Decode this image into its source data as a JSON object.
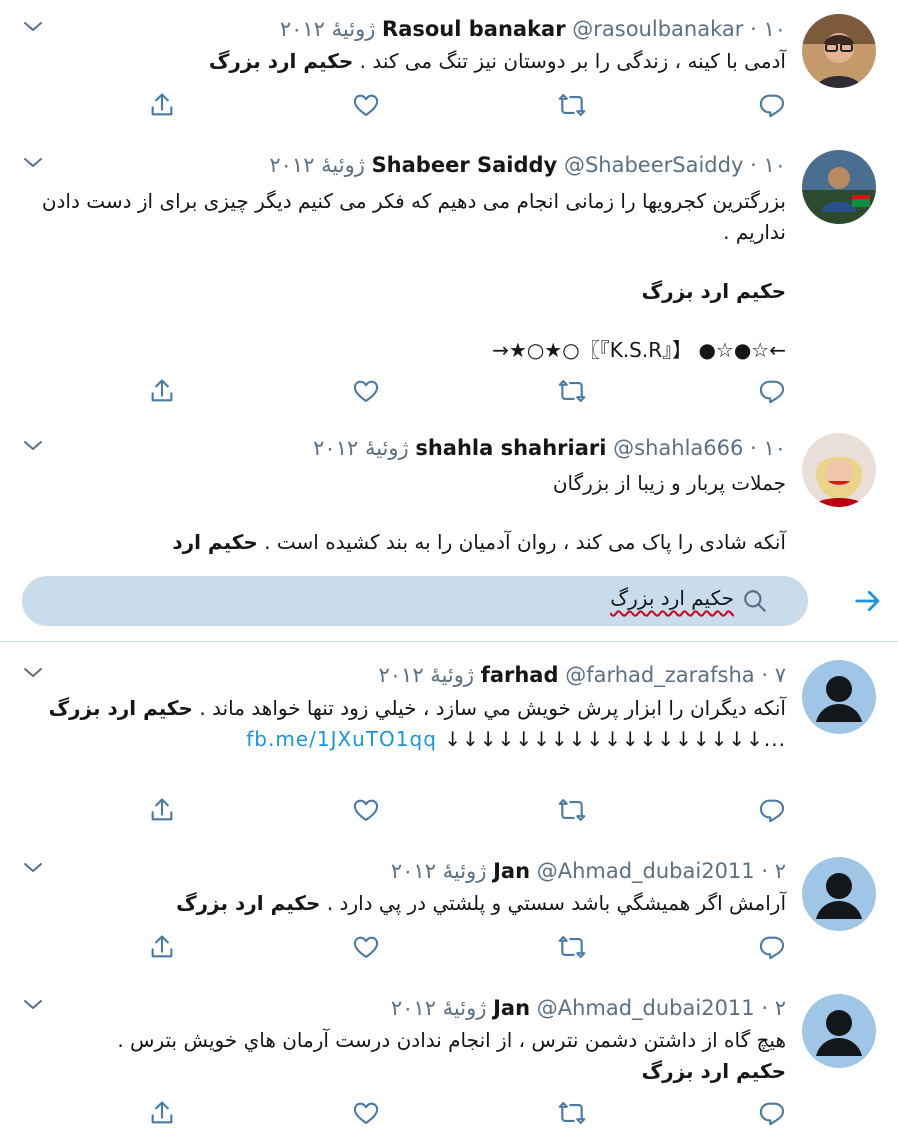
{
  "colors": {
    "accent": "#1b95e0",
    "border": "#c9dcec",
    "muted": "#5b7083",
    "search_bg": "#c9dcec"
  },
  "search": {
    "query": "حکیم ارد بزرگ"
  },
  "tweets": [
    {
      "name": "Rasoul banakar",
      "handle": "@rasoulbanakar",
      "sep": "·",
      "date": "۱۰ ژوئیهٔ ۲۰۱۲",
      "line1": "آدمی با کینه ، زندگی را بر دوستان نیز تنگ می کند .",
      "bold1": "حکیم ارد بزرگ"
    },
    {
      "name": "Shabeer Saiddy",
      "handle": "@ShabeerSaiddy",
      "sep": "·",
      "date": "۱۰ ژوئیهٔ ۲۰۱۲",
      "line1": "بزرگترین کجرویها را زمانی انجام می دهیم که فکر می کنیم دیگر چیزی برای از دست دادن نداریم .",
      "bold1": "حکیم ارد بزرگ",
      "line3": "←☆●☆● 【『K.S.R』〗○★○★→"
    },
    {
      "name": "shahla shahriari",
      "handle": "@shahla666",
      "sep": "·",
      "date": "۱۰ ژوئیهٔ ۲۰۱۲",
      "line1": "جملات پربار و زیبا از بزرگان",
      "line2": "آنکه شادی را پاک می کند ، روان آدمیان را به بند کشیده است .",
      "bold1": "حکیم ارد"
    },
    {
      "name": "farhad",
      "handle": "@farhad_zarafsha",
      "sep": "·",
      "date": "۷ ژوئیهٔ ۲۰۱۲",
      "line1": "آنکه دیگران را ابزار پرش خويش مي سازد ، خيلي زود تنها خواهد ماند .",
      "bold1": "حکیم ارد بزرگ",
      "arrows": "↓↓↓↓↓↓↓↓↓↓↓↓↓↓↓↓↓↓...",
      "link": "fb.me/1JXuTO1qq"
    },
    {
      "name": "Jan",
      "handle": "@Ahmad_dubai2011",
      "sep": "·",
      "date": "۲ ژوئیهٔ ۲۰۱۲",
      "line1": "آرامش اگر هميشگي باشد سستي و پلشتي در پي دارد .",
      "bold1": "حکیم ارد بزرگ"
    },
    {
      "name": "Jan",
      "handle": "@Ahmad_dubai2011",
      "sep": "·",
      "date": "۲ ژوئیهٔ ۲۰۱۲",
      "line1": "هيچ گاه از داشتن دشمن نترس ، از انجام ندادن درست آرمان هاي خويش بترس .",
      "bold1": "حکیم ارد بزرگ"
    }
  ]
}
